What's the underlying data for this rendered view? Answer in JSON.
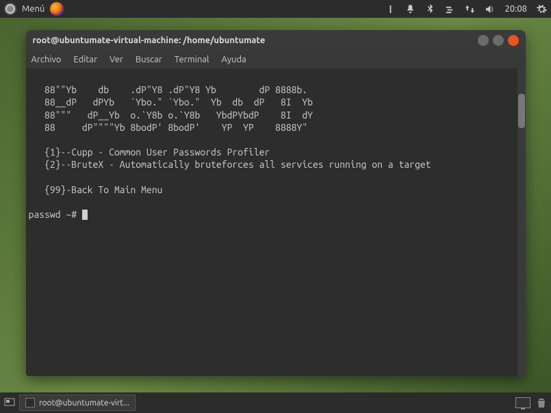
{
  "topbar": {
    "menu_label": "Menú",
    "clock": "20:08"
  },
  "window": {
    "title": "root@ubuntumate-virtual-machine: /home/ubuntumate",
    "menu": {
      "archivo": "Archivo",
      "editar": "Editar",
      "ver": "Ver",
      "buscar": "Buscar",
      "terminal": "Terminal",
      "ayuda": "Ayuda"
    }
  },
  "terminal": {
    "ascii": "   88\"\"Yb    db    .dP\"Y8 .dP\"Y8 Yb        dP 8888b.\n   88__dP   dPYb   `Ybo.\" `Ybo.\"  Yb  db  dP   8I  Yb\n   88\"\"\"   dP__Yb  o.`Y8b o.`Y8b   YbdPYbdP    8I  dY\n   88     dP\"\"\"\"Yb 8bodP' 8bodP'    YP  YP    8888Y\"",
    "opt1": "   {1}--Cupp - Common User Passwords Profiler",
    "opt2": "   {2}--BruteX - Automatically bruteforces all services running on a target",
    "opt99": "   {99}-Back To Main Menu",
    "prompt": "passwd ~# "
  },
  "taskbar": {
    "item_label": "root@ubuntumate-virt..."
  }
}
